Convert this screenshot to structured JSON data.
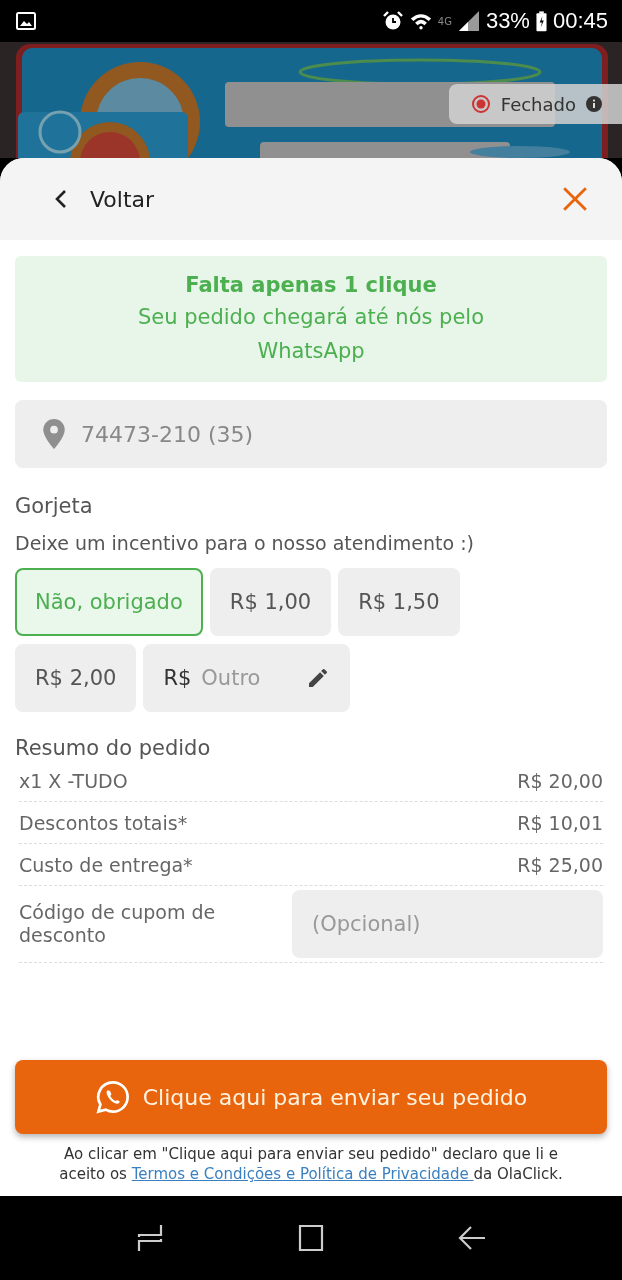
{
  "status_bar": {
    "network": "4G",
    "battery": "33%",
    "time": "00:45"
  },
  "banner": {
    "kind": "picture",
    "store_status": "Fechado"
  },
  "header": {
    "back_label": "Voltar"
  },
  "notice": {
    "title": "Falta apenas 1 clique",
    "text": "Seu pedido chegará até nós pelo WhatsApp"
  },
  "address": {
    "value": "74473-210 (35)"
  },
  "tip": {
    "title": "Gorjeta",
    "subtitle": "Deixe um incentivo para o nosso atendimento :)",
    "options": [
      {
        "kind": "amount",
        "label": "Não, obrigado",
        "selected": true
      },
      {
        "kind": "amount",
        "label": "R$ 1,00",
        "selected": false
      },
      {
        "kind": "amount",
        "label": "R$ 1,50",
        "selected": false
      },
      {
        "kind": "amount",
        "label": "R$ 2,00",
        "selected": false
      },
      {
        "kind": "custom",
        "prefix": "R$",
        "placeholder": "Outro",
        "selected": false
      }
    ]
  },
  "summary": {
    "title": "Resumo do pedido",
    "rows": [
      {
        "label": "x1 X -TUDO",
        "value": "R$ 20,00"
      },
      {
        "label": "Descontos totais*",
        "value": "R$ 10,01"
      },
      {
        "label": "Custo de entrega*",
        "value": "R$ 25,00"
      }
    ],
    "coupon": {
      "label": "Código de cupom de desconto",
      "placeholder": "(Opcional)"
    }
  },
  "send_button": {
    "label": "Clique aqui para enviar seu pedido"
  },
  "terms": {
    "before": "Ao clicar em \"Clique aqui para enviar seu pedido\" declaro que li e aceito os ",
    "link": "Termos e Condições e Política de Privacidade ",
    "after": "da OlaClick."
  }
}
